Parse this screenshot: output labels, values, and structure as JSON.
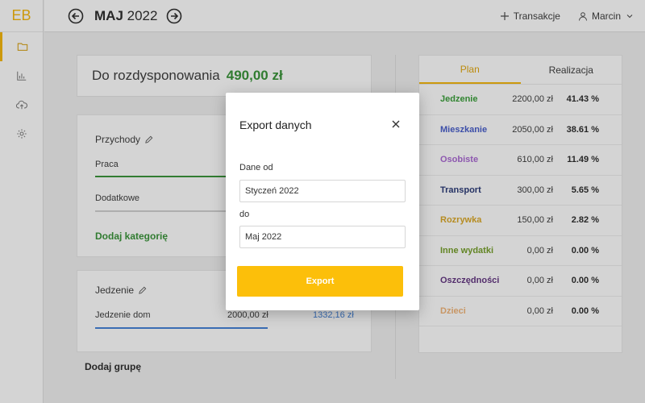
{
  "app": {
    "logo": "EB"
  },
  "sidebar": {
    "items": [
      {
        "icon": "folder-icon",
        "active": true
      },
      {
        "icon": "bar-chart-icon",
        "active": false
      },
      {
        "icon": "cloud-upload-icon",
        "active": false
      },
      {
        "icon": "gear-icon",
        "active": false
      }
    ]
  },
  "header": {
    "month_bold": "MAJ",
    "year": "2022",
    "transactions_label": "Transakcje",
    "user_name": "Marcin"
  },
  "budget": {
    "label": "Do rozdysponowania",
    "amount": "490,00 zł"
  },
  "income": {
    "title": "Przychody",
    "rows": [
      {
        "label": "Praca"
      },
      {
        "label": "Dodatkowe"
      }
    ],
    "add_category": "Dodaj kategorię"
  },
  "food_group": {
    "title": "Jedzenie",
    "row": {
      "label": "Jedzenie dom",
      "plan": "2000,00 zł",
      "real": "1332,16 zł"
    }
  },
  "add_group": "Dodaj grupę",
  "summary": {
    "tabs": [
      {
        "label": "Plan",
        "active": true
      },
      {
        "label": "Realizacja",
        "active": false
      }
    ],
    "rows": [
      {
        "name": "Jedzenie",
        "value": "2200,00 zł",
        "pct": "41.43 %",
        "color": "#2f9a2f"
      },
      {
        "name": "Mieszkanie",
        "value": "2050,00 zł",
        "pct": "38.61 %",
        "color": "#3e55c8"
      },
      {
        "name": "Osobiste",
        "value": "610,00 zł",
        "pct": "11.49 %",
        "color": "#a55fd0"
      },
      {
        "name": "Transport",
        "value": "300,00 zł",
        "pct": "5.65 %",
        "color": "#1f3070"
      },
      {
        "name": "Rozrywka",
        "value": "150,00 zł",
        "pct": "2.82 %",
        "color": "#d9a31c"
      },
      {
        "name": "Inne wydatki",
        "value": "0,00 zł",
        "pct": "0.00 %",
        "color": "#6e9a1e"
      },
      {
        "name": "Oszczędności",
        "value": "0,00 zł",
        "pct": "0.00 %",
        "color": "#5a2a7a"
      },
      {
        "name": "Dzieci",
        "value": "0,00 zł",
        "pct": "0.00 %",
        "color": "#f0b070"
      }
    ]
  },
  "modal": {
    "title": "Export danych",
    "from_label": "Dane od",
    "from_value": "Styczeń 2022",
    "to_label": "do",
    "to_value": "Maj 2022",
    "export_label": "Export"
  },
  "colors": {
    "accent": "#f5b400",
    "button": "#fcbf0a",
    "positive": "#2f8f2f",
    "link": "#3a7bd5"
  }
}
